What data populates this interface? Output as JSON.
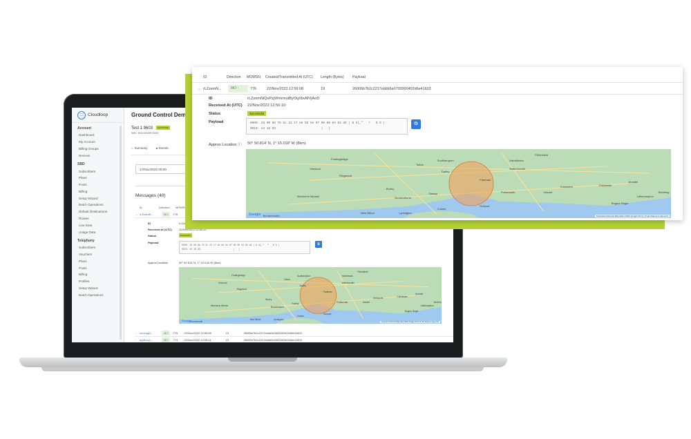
{
  "app": {
    "brand": "Cloudloop",
    "logo_mark": "Ground Control",
    "page_title": "Ground Control Demo"
  },
  "device": {
    "name": "Test 1 9603",
    "status_badge": "ACTIVATED",
    "imei": "IMEI: 300434065573630"
  },
  "sidebar": {
    "sections": [
      {
        "title": "Account",
        "items": [
          "Dashboard",
          "My Account",
          "Billing Groups",
          "Devices"
        ]
      },
      {
        "title": "SBD",
        "items": [
          "Subscribers",
          "Plans",
          "Pools",
          "Billing",
          "Setup Wizard",
          "Batch Operations",
          "Default Destinations",
          "Routes",
          "Live Data",
          "Usage Data"
        ]
      },
      {
        "title": "Telephony",
        "items": [
          "Subscribers",
          "Vouchers",
          "Plans",
          "Pools",
          "Billing",
          "Profiles",
          "Setup Wizard",
          "Batch Operations"
        ]
      }
    ]
  },
  "tabs": [
    "Summary",
    "Events"
  ],
  "filter": {
    "date": "17/Nov/2022 00:00"
  },
  "messages": {
    "heading": "Messages (40)"
  },
  "table": {
    "headers": [
      "ID",
      "Direction",
      "MOMSN",
      "Created/Transmitted At (UTC)",
      "Length (Bytes)",
      "Payload"
    ],
    "expanded_row": {
      "id": "rLZzemN...",
      "id_short": "rLZzemN...",
      "direction": "MO",
      "momsn": "776",
      "created": "22/Nov/2022 12:56:08",
      "length": "19",
      "payload": "26006b7b2c2217ebbb5e0700000402d6e41603"
    },
    "other_rows": [
      {
        "id": "oenLogD...",
        "direction": "MO",
        "momsn": "775",
        "created": "22/Nov/2022 12:55:59",
        "length": "19",
        "payload": "26006b7b2c2217ebbb5e0600000402d6e41603"
      },
      {
        "id": "aqdKzqL...",
        "direction": "MO",
        "momsn": "774",
        "created": "22/Nov/2022 12:55:41",
        "length": "19",
        "payload": "26006b7b2c2217ebbb5e0500000402d6e41603"
      }
    ]
  },
  "detail": {
    "id_label": "ID",
    "id_value": "rLZzemNiQvPzjWmrmutByOqXbvMVjAoD",
    "received_label": "Received At (UTC)",
    "received_value": "22/Nov/2022 12:56:10",
    "status_label": "Status",
    "status_value": "Successful",
    "payload_label": "Payload",
    "payload_hex_line1": "0000: 26 00 6b 7b 2c 22 17 eb bb 5e 07 00 00 04 02 d6",
    "payload_ascii_line1": "| & k{,\"   ^   D D |",
    "payload_hex_line2": "0010: e4 16 03",
    "payload_ascii_line2": "|   |",
    "location_label": "Approx Location",
    "location_value": "50° 50.814' N,   1° 15.018' W (8km)"
  },
  "map": {
    "places": [
      "Southampton",
      "Portsmouth",
      "Fordingbridge",
      "Ringwood",
      "Burley",
      "Brockenhurst",
      "Lymington",
      "New Milton",
      "Wimborne Minster",
      "Bournemouth",
      "Waterlooville",
      "Havant",
      "Chichester",
      "Littlehampton",
      "Worthing",
      "Bognor Regis",
      "Cowes",
      "Fareham",
      "Gosport",
      "Petersfield",
      "Hambledon",
      "Arundel",
      "Durley",
      "Totton",
      "Fawley",
      "Verwood",
      "Emsworth"
    ],
    "attribution": "Keyboard shortcuts  Map data ©2022 Google  Terms of Use  Report a map error",
    "google": "Google",
    "colors": {
      "land": "#bcdcb8",
      "water": "#9fc9ef",
      "circle_fill": "#f0a35c",
      "accent": "#b5d334",
      "link": "#2f6fcf"
    }
  }
}
